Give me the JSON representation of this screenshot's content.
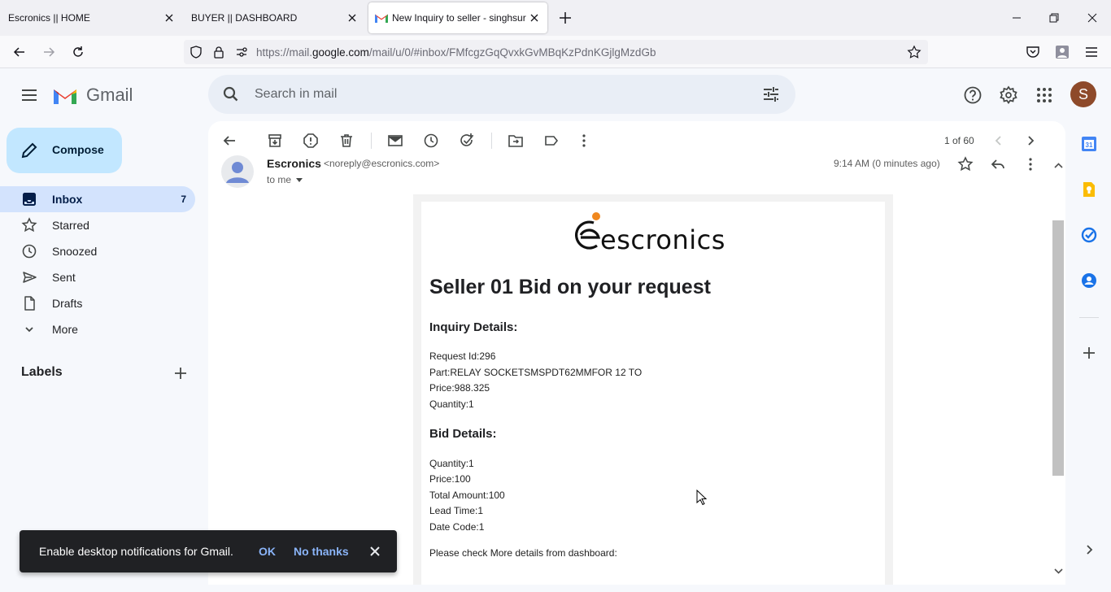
{
  "browser": {
    "tabs": [
      {
        "label": "Escronics || HOME",
        "active": false
      },
      {
        "label": "BUYER || DASHBOARD",
        "active": false
      },
      {
        "label": "New Inquiry to seller - singhsur",
        "active": true
      }
    ],
    "url_prefix": "https://mail.",
    "url_domain": "google.com",
    "url_rest": "/mail/u/0/#inbox/FMfcgzGqQvxkGvMBqKzPdnKGjlgMzdGb"
  },
  "gmail": {
    "logo_text": "Gmail",
    "search_placeholder": "Search in mail",
    "avatar_letter": "S",
    "compose_label": "Compose",
    "nav": [
      {
        "label": "Inbox",
        "count": "7",
        "icon": "inbox-icon",
        "active": true
      },
      {
        "label": "Starred",
        "count": "",
        "icon": "star-icon",
        "active": false
      },
      {
        "label": "Snoozed",
        "count": "",
        "icon": "clock-icon",
        "active": false
      },
      {
        "label": "Sent",
        "count": "",
        "icon": "send-icon",
        "active": false
      },
      {
        "label": "Drafts",
        "count": "",
        "icon": "draft-icon",
        "active": false
      },
      {
        "label": "More",
        "count": "",
        "icon": "chevron-down-icon",
        "active": false
      }
    ],
    "labels_title": "Labels",
    "toolbar": {
      "page_count": "1 of 60"
    },
    "message": {
      "sender_name": "Escronics",
      "sender_email": "<noreply@escronics.com>",
      "to": "to me",
      "time": "9:14 AM (0 minutes ago)"
    },
    "snackbar": {
      "text": "Enable desktop notifications for Gmail.",
      "ok": "OK",
      "no_thanks": "No thanks"
    }
  },
  "email_body": {
    "brand": "escronics",
    "heading": "Seller 01 Bid on your request",
    "inquiry_title": "Inquiry Details:",
    "inquiry_lines": [
      "Request Id:296",
      "Part:RELAY SOCKETSMSPDT62MMFOR 12 TO",
      "Price:988.325",
      "Quantity:1"
    ],
    "bid_title": "Bid Details:",
    "bid_lines": [
      "Quantity:1",
      "Price:100",
      "Total Amount:100",
      "Lead Time:1",
      "Date Code:1"
    ],
    "footer_line": "Please check More details from dashboard:"
  },
  "colors": {
    "compose_bg": "#c2e7ff",
    "active_nav_bg": "#d3e3fd",
    "avatar_bg": "#8e4a2a",
    "brand_orange": "#f0881f",
    "snackbar_link": "#8ab4f8"
  }
}
